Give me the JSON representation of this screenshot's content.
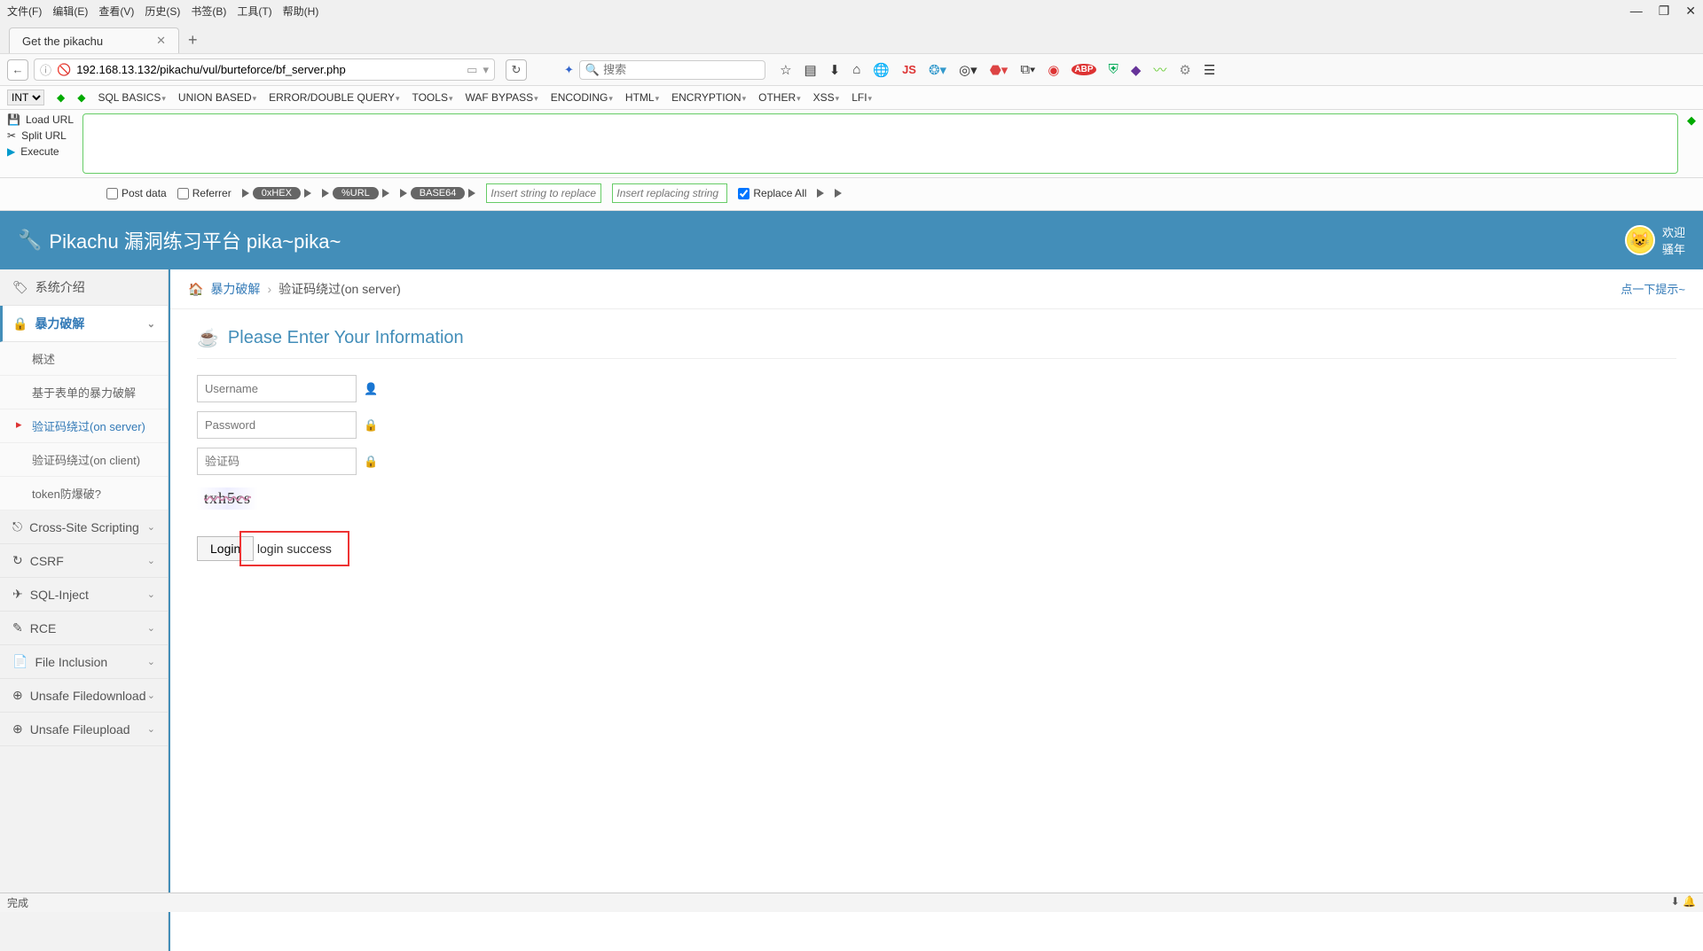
{
  "menubar": [
    "文件(F)",
    "编辑(E)",
    "查看(V)",
    "历史(S)",
    "书签(B)",
    "工具(T)",
    "帮助(H)"
  ],
  "window": {
    "minimize": "—",
    "maximize": "❐",
    "close": "✕"
  },
  "tab": {
    "title": "Get the pikachu",
    "close": "✕",
    "new": "+"
  },
  "nav": {
    "back": "←",
    "url": "192.168.13.132/pikachu/vul/burteforce/bf_server.php",
    "search_placeholder": "搜索"
  },
  "hackbar": {
    "int": "INT",
    "menus": [
      "SQL BASICS",
      "UNION BASED",
      "ERROR/DOUBLE QUERY",
      "TOOLS",
      "WAF BYPASS",
      "ENCODING",
      "HTML",
      "ENCRYPTION",
      "OTHER",
      "XSS",
      "LFI"
    ],
    "side": [
      "Load URL",
      "Split URL",
      "Execute"
    ],
    "row3": {
      "post": "Post data",
      "ref": "Referrer",
      "chips": [
        "0xHEX",
        "%URL",
        "BASE64"
      ],
      "in1": "Insert string to replace",
      "in2": "Insert replacing string",
      "replace": "Replace All"
    }
  },
  "header": {
    "title": "Pikachu 漏洞练习平台 pika~pika~",
    "welcome": "欢迎",
    "nick": "骚年"
  },
  "sidebar": {
    "intro": "系统介绍",
    "brute": "暴力破解",
    "subs": [
      "概述",
      "基于表单的暴力破解",
      "验证码绕过(on server)",
      "验证码绕过(on client)",
      "token防爆破?"
    ],
    "rest": [
      "Cross-Site Scripting",
      "CSRF",
      "SQL-Inject",
      "RCE",
      "File Inclusion",
      "Unsafe Filedownload",
      "Unsafe Fileupload"
    ]
  },
  "breadcrumb": {
    "a": "暴力破解",
    "b": "验证码绕过(on server)",
    "hint": "点一下提示~"
  },
  "form": {
    "title": "Please Enter Your Information",
    "user_ph": "Username",
    "pass_ph": "Password",
    "code_ph": "验证码",
    "captcha": "txh5cs",
    "login": "Login",
    "result": "login success"
  },
  "status": {
    "left": "完成",
    "right": ""
  }
}
